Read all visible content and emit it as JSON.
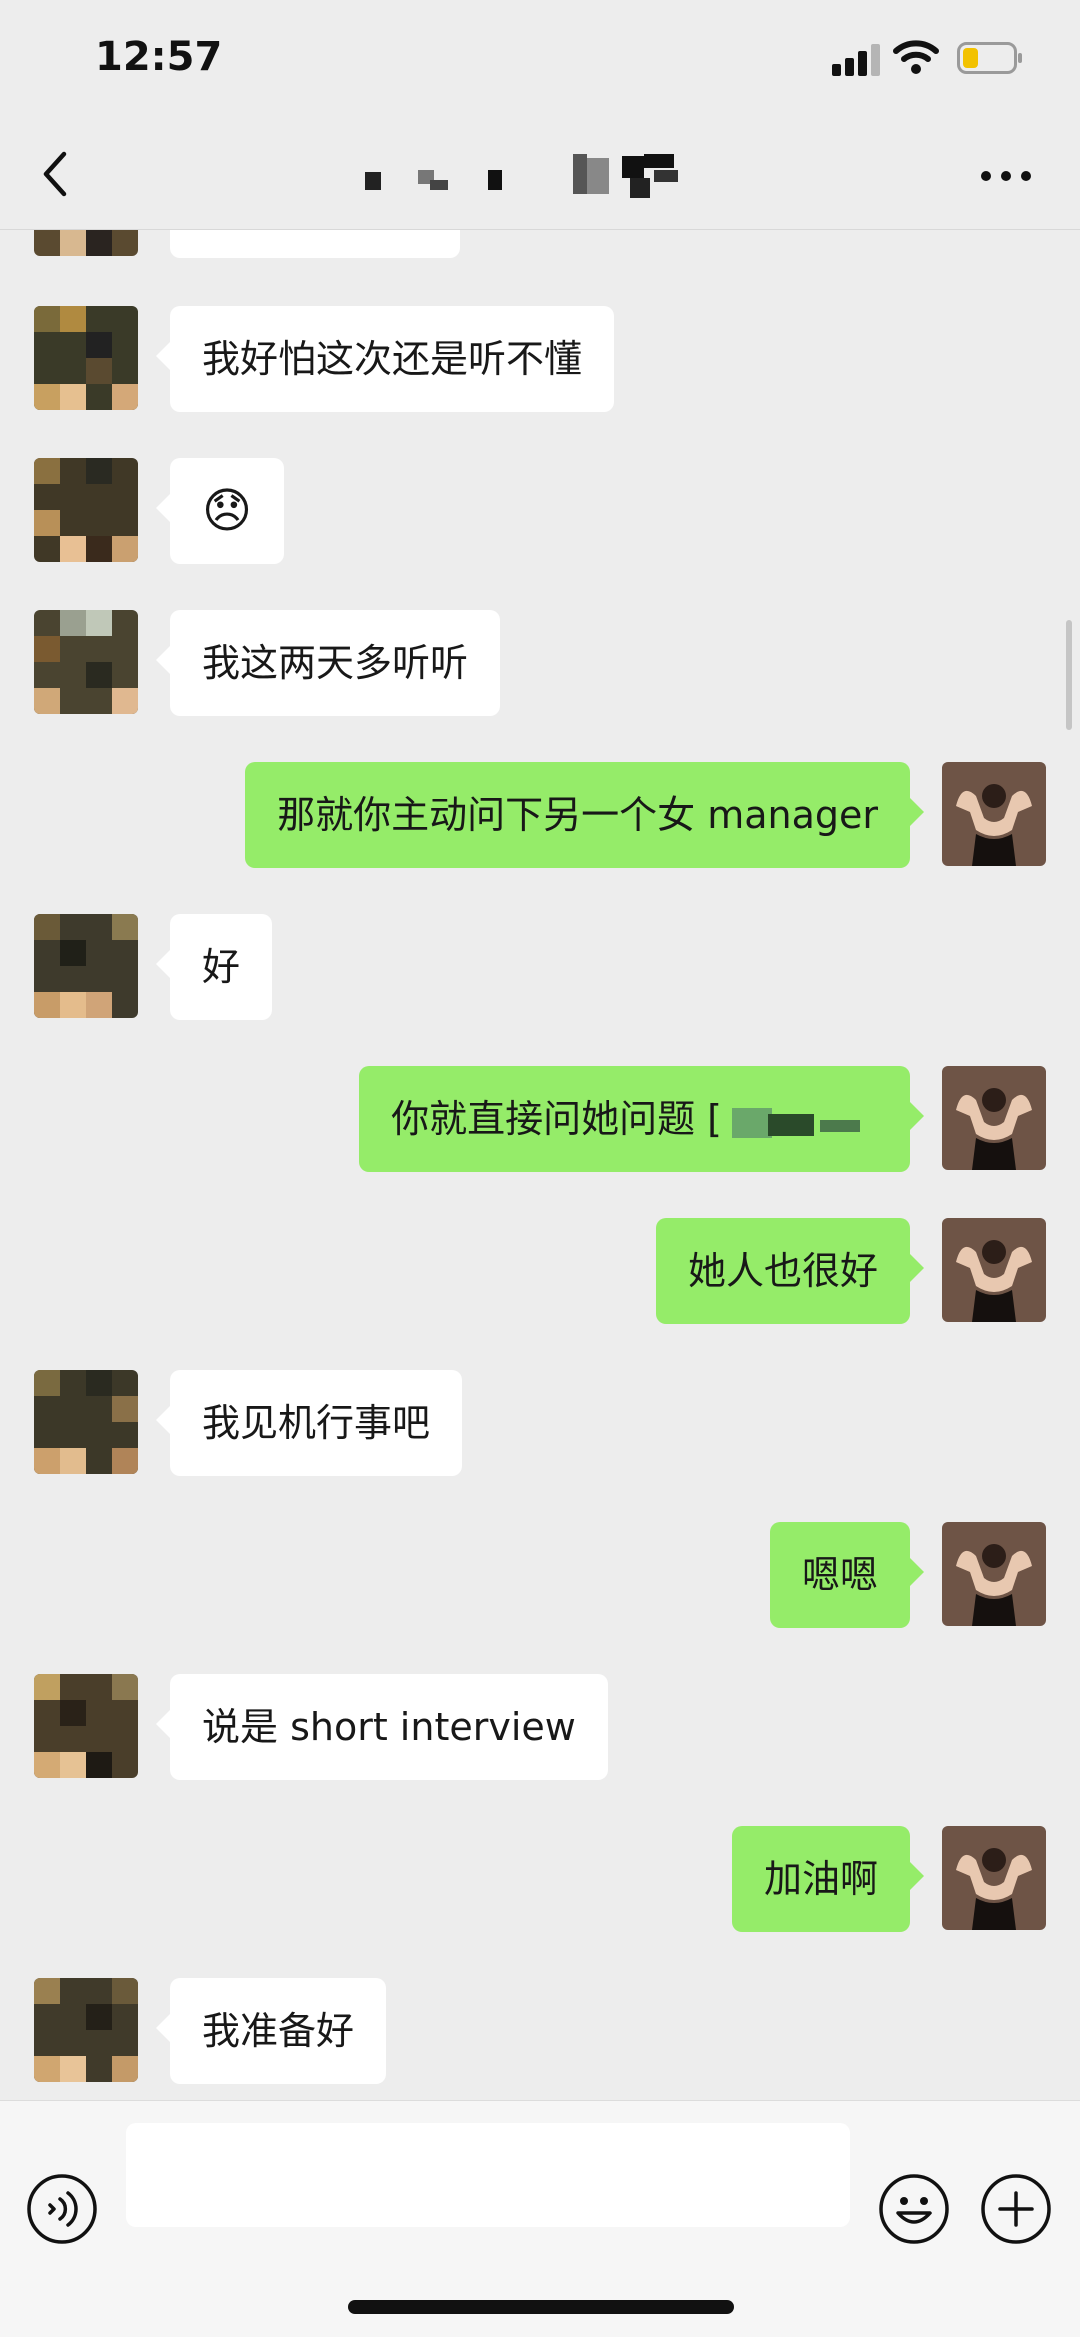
{
  "status_bar": {
    "time": "12:57"
  },
  "nav": {
    "title_icon": "redacted-contact-name"
  },
  "colors": {
    "background": "#ededed",
    "sent_bubble": "#95ec69",
    "received_bubble": "#ffffff"
  },
  "messages": [
    {
      "side": "left",
      "text": ""
    },
    {
      "side": "left",
      "text": "我好怕这次还是听不懂"
    },
    {
      "side": "left",
      "text": "😞"
    },
    {
      "side": "left",
      "text": "我这两天多听听"
    },
    {
      "side": "right",
      "text": "那就你主动问下另一个女 manager"
    },
    {
      "side": "left",
      "text": "好"
    },
    {
      "side": "right",
      "text": "你就直接问她问题 ["
    },
    {
      "side": "right",
      "text": "她人也很好"
    },
    {
      "side": "left",
      "text": "我见机行事吧"
    },
    {
      "side": "right",
      "text": "嗯嗯"
    },
    {
      "side": "left",
      "text": "说是 short interview"
    },
    {
      "side": "right",
      "text": "加油啊"
    },
    {
      "side": "left",
      "text": "我准备好"
    }
  ],
  "input": {
    "placeholder": ""
  }
}
